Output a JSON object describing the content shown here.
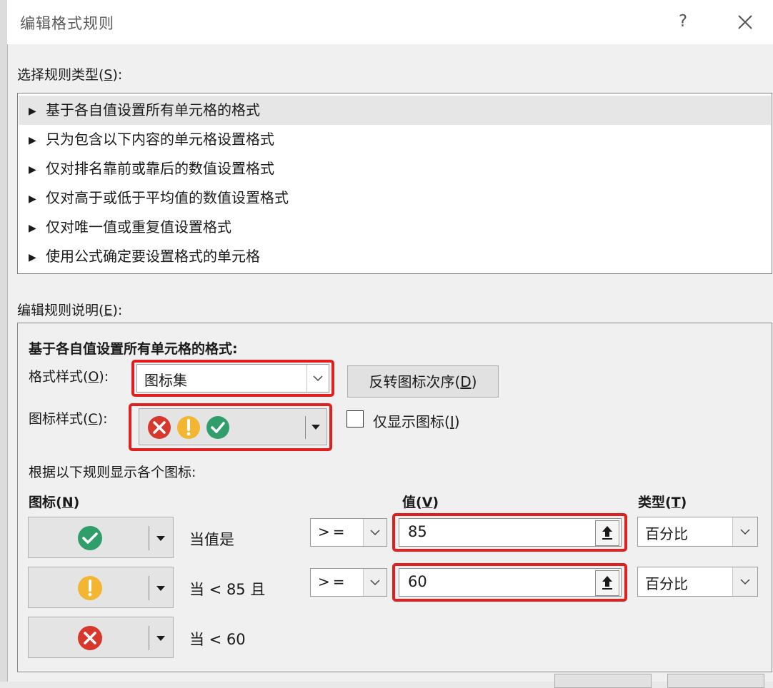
{
  "window": {
    "title": "编辑格式规则",
    "help": "?",
    "close_icon": "close-icon"
  },
  "rule_type": {
    "label": "选择规则类型(",
    "label_key": "S",
    "label_end": "):",
    "items": [
      {
        "label": "基于各自值设置所有单元格的格式",
        "selected": true
      },
      {
        "label": "只为包含以下内容的单元格设置格式",
        "selected": false
      },
      {
        "label": "仅对排名靠前或靠后的数值设置格式",
        "selected": false
      },
      {
        "label": "仅对高于或低于平均值的数值设置格式",
        "selected": false
      },
      {
        "label": "仅对唯一值或重复值设置格式",
        "selected": false
      },
      {
        "label": "使用公式确定要设置格式的单元格",
        "selected": false
      }
    ]
  },
  "edit_rule": {
    "label": "编辑规则说明(",
    "label_key": "E",
    "label_end": "):",
    "title": "基于各自值设置所有单元格的格式:",
    "format_style_label": "格式样式(",
    "format_style_key": "O",
    "format_style_end": "):",
    "format_style_value": "图标集",
    "reverse_button_prefix": "反转图标次序(",
    "reverse_button_key": "D",
    "reverse_button_end": ")",
    "icon_style_label": "图标样式(",
    "icon_style_key": "C",
    "icon_style_end": "):",
    "show_icon_only_prefix": "仅显示图标(",
    "show_icon_only_key": "I",
    "show_icon_only_end": ")",
    "show_icon_only_checked": false,
    "rules_caption": "根据以下规则显示各个图标:",
    "col_icon": "图标(",
    "col_icon_key": "N",
    "col_icon_end": ")",
    "col_value": "值(",
    "col_value_key": "V",
    "col_value_end": ")",
    "col_type": "类型(",
    "col_type_key": "T",
    "col_type_end": ")",
    "rows": [
      {
        "icon": "green-check-icon",
        "condition": "当值是",
        "operator": ">=",
        "value": "85",
        "type": "百分比"
      },
      {
        "icon": "yellow-exclamation-icon",
        "condition": "当 < 85 且",
        "operator": ">=",
        "value": "60",
        "type": "百分比"
      },
      {
        "icon": "red-x-icon",
        "condition": "当 < 60"
      }
    ]
  },
  "colors": {
    "highlight_red": "#e01f1f",
    "check_green": "#2f9e6a",
    "warn_yellow": "#f2b632",
    "error_red": "#d8382c"
  }
}
